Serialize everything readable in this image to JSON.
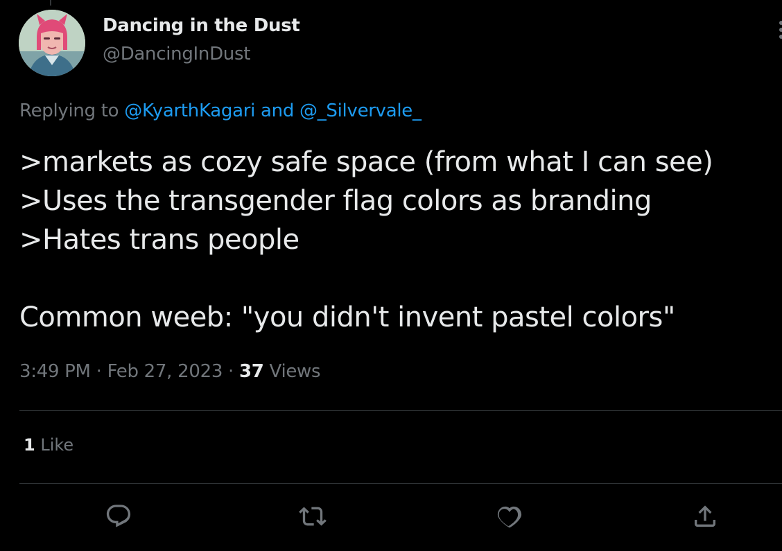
{
  "author": {
    "display_name": "Dancing in the Dust",
    "handle": "@DancingInDust"
  },
  "reply_context": {
    "prefix": "Replying to ",
    "mention_1": "@KyarthKagari",
    "joiner": " and ",
    "mention_2": "@_Silvervale_"
  },
  "tweet": {
    "lines": [
      ">markets as cozy safe space (from what I can see)",
      ">Uses the transgender flag colors as branding",
      ">Hates trans people",
      "Common weeb: \"you didn't invent pastel colors\""
    ]
  },
  "meta": {
    "time": "3:49 PM",
    "separator": " · ",
    "date": "Feb 27, 2023",
    "views_count": "37",
    "views_label": " Views"
  },
  "stats": {
    "likes_count": "1",
    "likes_label": " Like"
  },
  "actions": {
    "reply_icon": "reply-bubble-icon",
    "retweet_icon": "retweet-icon",
    "like_icon": "heart-icon",
    "share_icon": "share-upload-icon"
  },
  "colors": {
    "background": "#000000",
    "text_primary": "#e7e9ea",
    "text_secondary": "#71767b",
    "link": "#1d9bf0",
    "divider": "#2f3336"
  }
}
